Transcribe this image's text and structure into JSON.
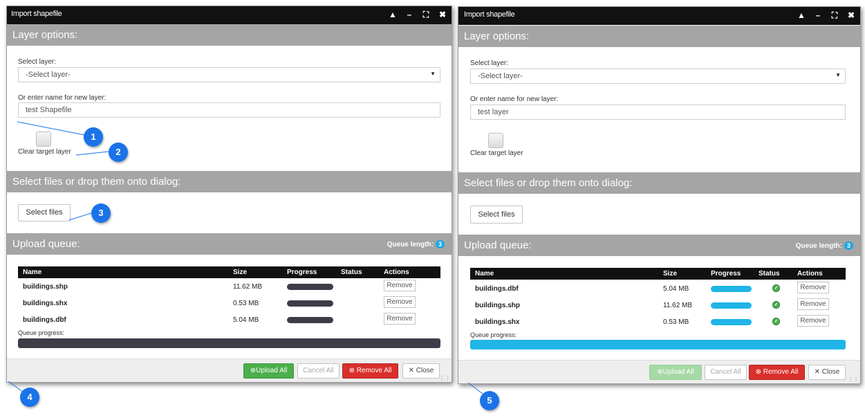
{
  "left_dialog": {
    "title": "Import shapefile",
    "layer_options_header": "Layer options:",
    "select_layer_label": "Select layer:",
    "select_layer_value": "-Select layer-",
    "new_layer_label": "Or enter name for new layer:",
    "new_layer_value": "test Shapefile",
    "clear_target_label": "Clear target layer",
    "select_files_header": "Select files or drop them onto dialog:",
    "select_files_button": "Select files",
    "upload_queue_header": "Upload queue:",
    "queue_length_label": "Queue length:",
    "queue_length_value": "3",
    "columns": {
      "name": "Name",
      "size": "Size",
      "progress": "Progress",
      "status": "Status",
      "actions": "Actions"
    },
    "rows": [
      {
        "name": "buildings.shp",
        "size": "11.62 MB",
        "progress": 0,
        "remove": "Remove"
      },
      {
        "name": "buildings.shx",
        "size": "0.53 MB",
        "progress": 0,
        "remove": "Remove"
      },
      {
        "name": "buildings.dbf",
        "size": "5.04 MB",
        "progress": 0,
        "remove": "Remove"
      }
    ],
    "queue_progress_label": "Queue progress:",
    "queue_progress": 0,
    "buttons": {
      "upload_all": "Upload All",
      "cancel_all": "Cancel All",
      "remove_all": "Remove All",
      "close": "Close"
    }
  },
  "right_dialog": {
    "title": "Import shapefile",
    "layer_options_header": "Layer options:",
    "select_layer_label": "Select layer:",
    "select_layer_value": "-Select layer-",
    "new_layer_label": "Or enter name for new layer:",
    "new_layer_value": "test layer",
    "clear_target_label": "Clear target layer",
    "select_files_header": "Select files or drop them onto dialog:",
    "select_files_button": "Select files",
    "upload_queue_header": "Upload queue:",
    "queue_length_label": "Queue length:",
    "queue_length_value": "3",
    "columns": {
      "name": "Name",
      "size": "Size",
      "progress": "Progress",
      "status": "Status",
      "actions": "Actions"
    },
    "rows": [
      {
        "name": "buildings.dbf",
        "size": "5.04 MB",
        "progress": 100,
        "remove": "Remove"
      },
      {
        "name": "buildings.shp",
        "size": "11.62 MB",
        "progress": 100,
        "remove": "Remove"
      },
      {
        "name": "buildings.shx",
        "size": "0.53 MB",
        "progress": 100,
        "remove": "Remove"
      }
    ],
    "queue_progress_label": "Queue progress:",
    "queue_progress": 100,
    "buttons": {
      "upload_all": "Upload All",
      "cancel_all": "Cancel All",
      "remove_all": "Remove All",
      "close": "Close"
    }
  },
  "callouts": [
    "1",
    "2",
    "3",
    "4",
    "5"
  ],
  "colors": {
    "titlebar": "#111111",
    "section_header": "#a5a5a5",
    "progress_pending": "#3d3d4a",
    "progress_done": "#1fb5e6",
    "upload_green": "#4cae4c",
    "remove_red": "#d9302c",
    "callout_blue": "#1a73e8"
  }
}
